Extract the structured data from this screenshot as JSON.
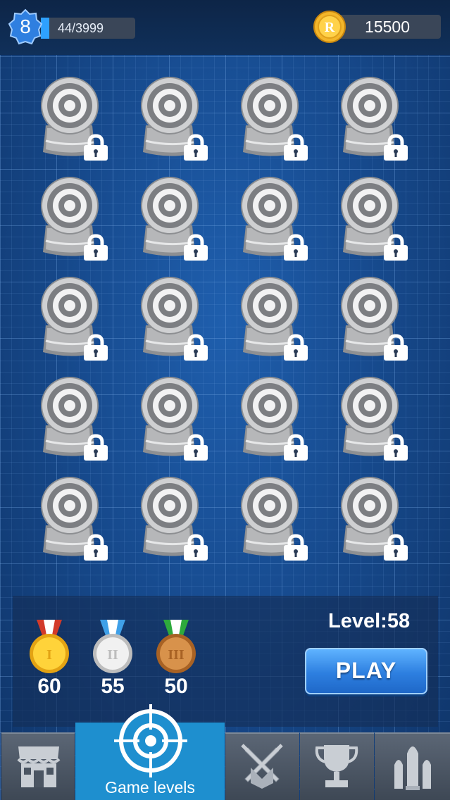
{
  "header": {
    "player_level": "8",
    "xp_text": "44/3999",
    "xp_fraction": 0.011,
    "coins": "15500",
    "coin_symbol": "R"
  },
  "levels": {
    "rows": 5,
    "columns": 4,
    "state": "locked",
    "icon": "target-icon",
    "lock_icon": "padlock-icon"
  },
  "medals": [
    {
      "name": "gold-medal",
      "numeral": "I",
      "count": "60",
      "ribbon": "#d23a2a"
    },
    {
      "name": "silver-medal",
      "numeral": "II",
      "count": "55",
      "ribbon": "#3fa0e8"
    },
    {
      "name": "bronze-medal",
      "numeral": "III",
      "count": "50",
      "ribbon": "#2eaa3c"
    }
  ],
  "level_label": "Level:58",
  "play_label": "PLAY",
  "nav": {
    "items": [
      {
        "name": "shop",
        "icon": "shop-icon",
        "label": ""
      },
      {
        "name": "game-levels",
        "icon": "crosshair-icon",
        "label": "Game levels",
        "active": true
      },
      {
        "name": "battle",
        "icon": "crossed-swords-icon",
        "label": ""
      },
      {
        "name": "trophy",
        "icon": "trophy-icon",
        "label": ""
      },
      {
        "name": "ammo",
        "icon": "bullets-icon",
        "label": ""
      }
    ]
  },
  "colors": {
    "accent": "#1e8fcf",
    "background": "#174b8f",
    "xp_bar": "#2ea1ff",
    "play_button": "#2d7fe0"
  }
}
